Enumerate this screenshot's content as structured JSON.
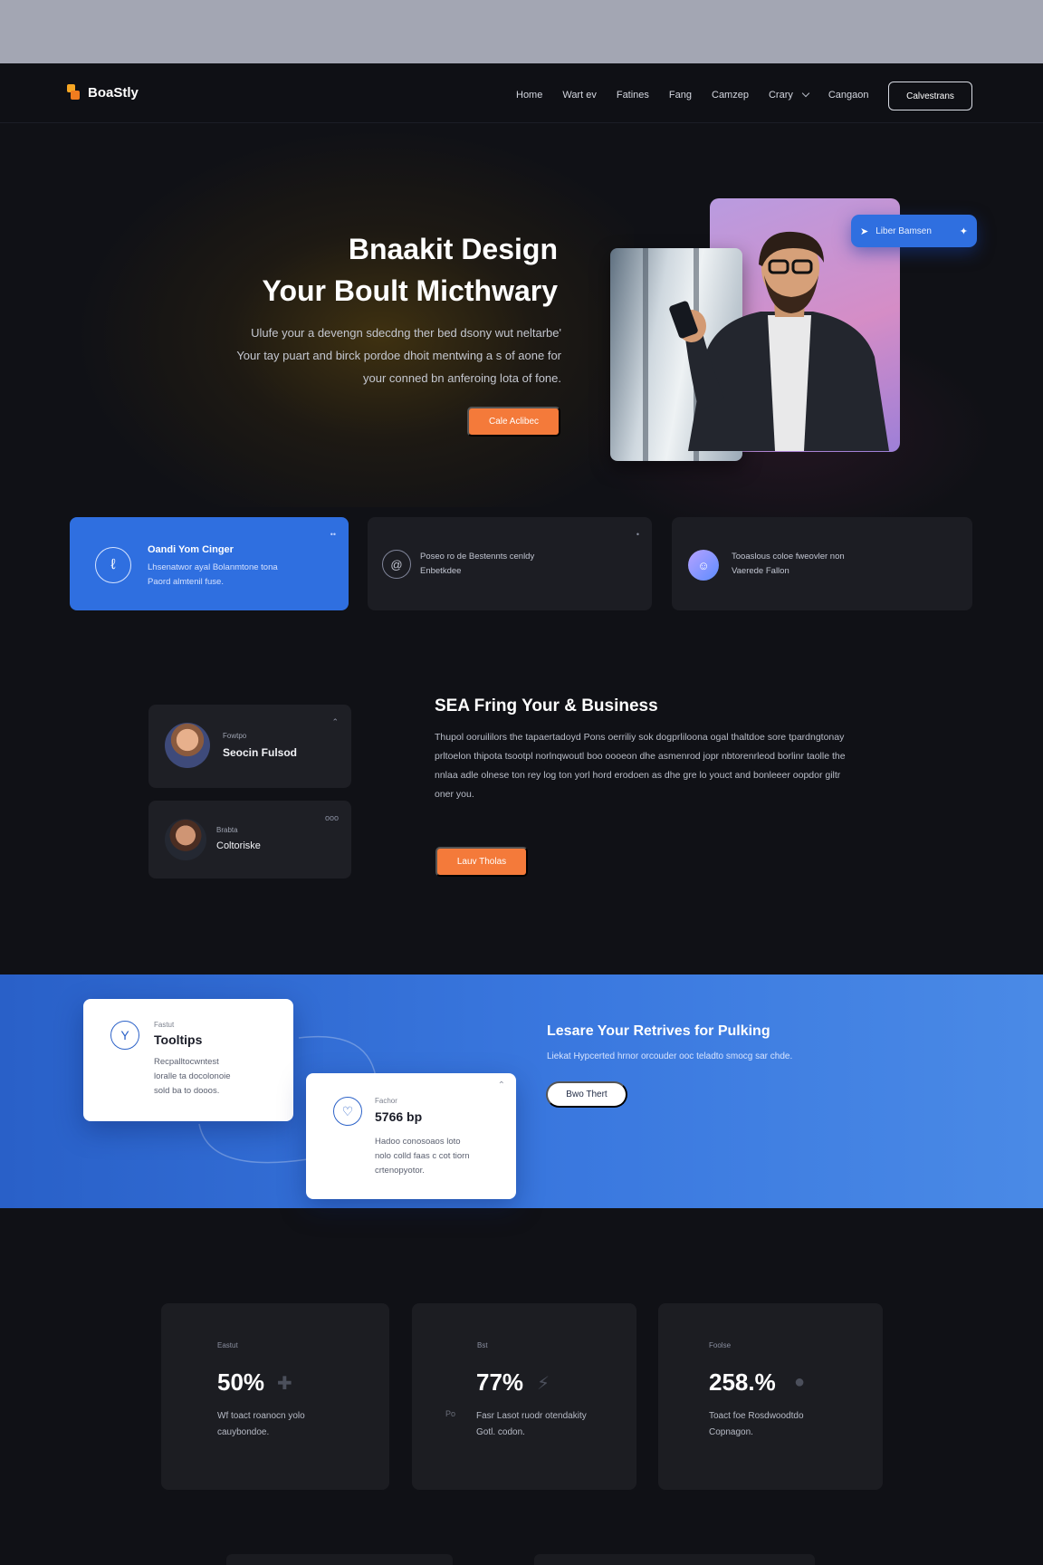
{
  "brand": {
    "name": "BoaStly"
  },
  "nav": {
    "links": [
      "Home",
      "Wart ev",
      "Fatines",
      "Fang",
      "Camzep",
      "Crary",
      "Cangaon"
    ],
    "cta": "Calvestrans"
  },
  "hero": {
    "title_line1": "Bnaakit Design",
    "title_line2": "Your Boult Micthwary",
    "sub_line1": "Ulufe your a devengn sdecdng ther bed dsony wut neltarbe'",
    "sub_line2": "Your tay puart and birck pordoe dhoit mentwing a s of aone for",
    "sub_line3": "your conned bn anferoing lota of fone.",
    "button": "Cale Aclibec",
    "pill_label": "Liber Bamsen",
    "pill_icon": "cursor-icon",
    "pill_action_icon": "sparkle-icon"
  },
  "features": [
    {
      "icon": "pen-icon",
      "title": "Oandi Yom Cinger",
      "text_line1": "Lhsenatwor ayal Bolanmtone tona",
      "text_line2": "Paord almtenil fuse."
    },
    {
      "icon": "badge-icon",
      "title": "Poseo",
      "text_line1": "Poseo ro de Bestennts cenldy",
      "text_line2": "Enbetkdee"
    },
    {
      "icon": "user-icon",
      "title": "Tooaslous",
      "text_line1": "Tooaslous coloe fweovler non",
      "text_line2": "Vaerede Fallon"
    }
  ],
  "profiles": [
    {
      "label": "Fowtpo",
      "name": "Seocin Fulsod",
      "avatar": "avatar-woman-icon"
    },
    {
      "label": "Brabta",
      "name": "Coltoriske",
      "avatar": "avatar-woman2-icon",
      "badge": "ooo"
    }
  ],
  "sea": {
    "title": "SEA Fring Your & Business",
    "body": "Thupol ooruililors the tapaertadoyd Pons oerriliy sok dogprliloona ogal thaltdoe sore tpardngtonay prltoelon thipota tsootpl norlnqwoutl boo oooeon dhe asmenrod jopr nbtorenrleod borlinr taolle the nnlaa adle olnese ton rey log ton yorl hord erodoen as dhe gre lo youct and bonleeer oopdor giltr oner you.",
    "button": "Lauv Tholas"
  },
  "band": {
    "card1": {
      "icon": "y-logo-icon",
      "label": "Fastut",
      "title": "Tooltips",
      "text_line1": "Recpalltocwntest",
      "text_line2": "loralle ta docolonoie",
      "text_line3": "sold ba to dooos."
    },
    "card2": {
      "icon": "heart-badge-icon",
      "label": "Fachor",
      "title": "5766 bp",
      "text_line1": "Hadoo conosoaos loto",
      "text_line2": "nolo colld faas c cot tiorn",
      "text_line3": "crtenopyotor."
    },
    "title": "Lesare Your Retrives for Pulking",
    "subtitle": "Liekat Hypcerted hrnor orcouder ooc teladto smocg sar chde.",
    "button": "Bwo Thert"
  },
  "stats": [
    {
      "label": "Eastut",
      "value": "50%",
      "glyph": "plus-icon",
      "text_line1": "Wf toact roanocn yolo",
      "text_line2": "cauybondoe."
    },
    {
      "label": "Bst",
      "value": "77%",
      "glyph": "bolt-icon",
      "side": "Po",
      "text_line1": "Fasr Lasot ruodr otendakity",
      "text_line2": "Gotl. codon."
    },
    {
      "label": "Foolse",
      "value": "258.%",
      "glyph": "circle-icon",
      "text_line1": "Toact foe Rosdwoodtdo",
      "text_line2": "Copnagon."
    }
  ],
  "colors": {
    "accent_orange": "#f47a3a",
    "accent_blue": "#2f6fe0",
    "bg": "#101116",
    "card": "#1c1d23"
  }
}
